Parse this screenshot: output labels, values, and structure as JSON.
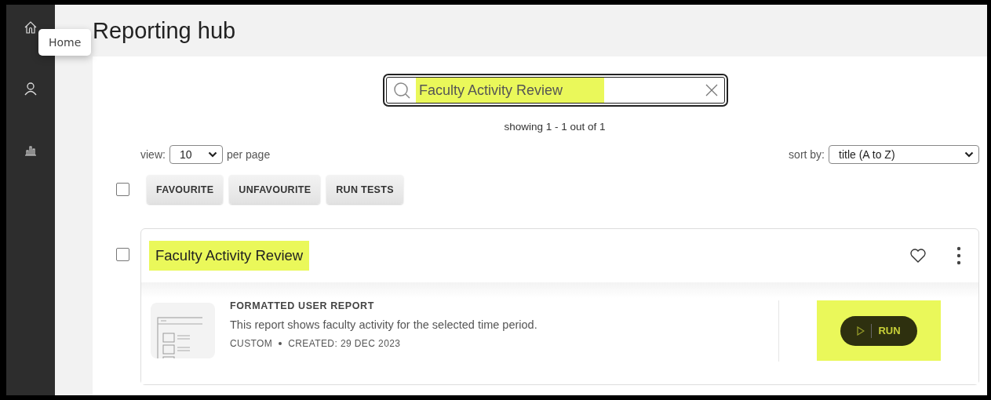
{
  "sidebar": {
    "items": [
      {
        "kind": "home",
        "tooltip": "Home"
      },
      {
        "kind": "user"
      },
      {
        "kind": "chart"
      }
    ]
  },
  "page_title": "Reporting hub",
  "search": {
    "value": "Faculty Activity Review",
    "highlighted": true
  },
  "result_count": "showing 1 - 1 out of 1",
  "view": {
    "label": "view:",
    "value": "10",
    "suffix": "per page"
  },
  "sort": {
    "label": "sort by:",
    "value": "title (A to Z)"
  },
  "select_all": {
    "checked": false
  },
  "actions": [
    "FAVOURITE",
    "UNFAVOURITE",
    "RUN TESTS"
  ],
  "reports": [
    {
      "title": "Faculty Activity Review",
      "highlighted": true,
      "checked": false,
      "favourite": false,
      "type": "FORMATTED USER REPORT",
      "description": "This report shows faculty activity for the selected time period.",
      "category": "CUSTOM",
      "created": "CREATED: 29 DEC 2023",
      "run": {
        "label": "RUN",
        "highlighted": true
      }
    }
  ]
}
